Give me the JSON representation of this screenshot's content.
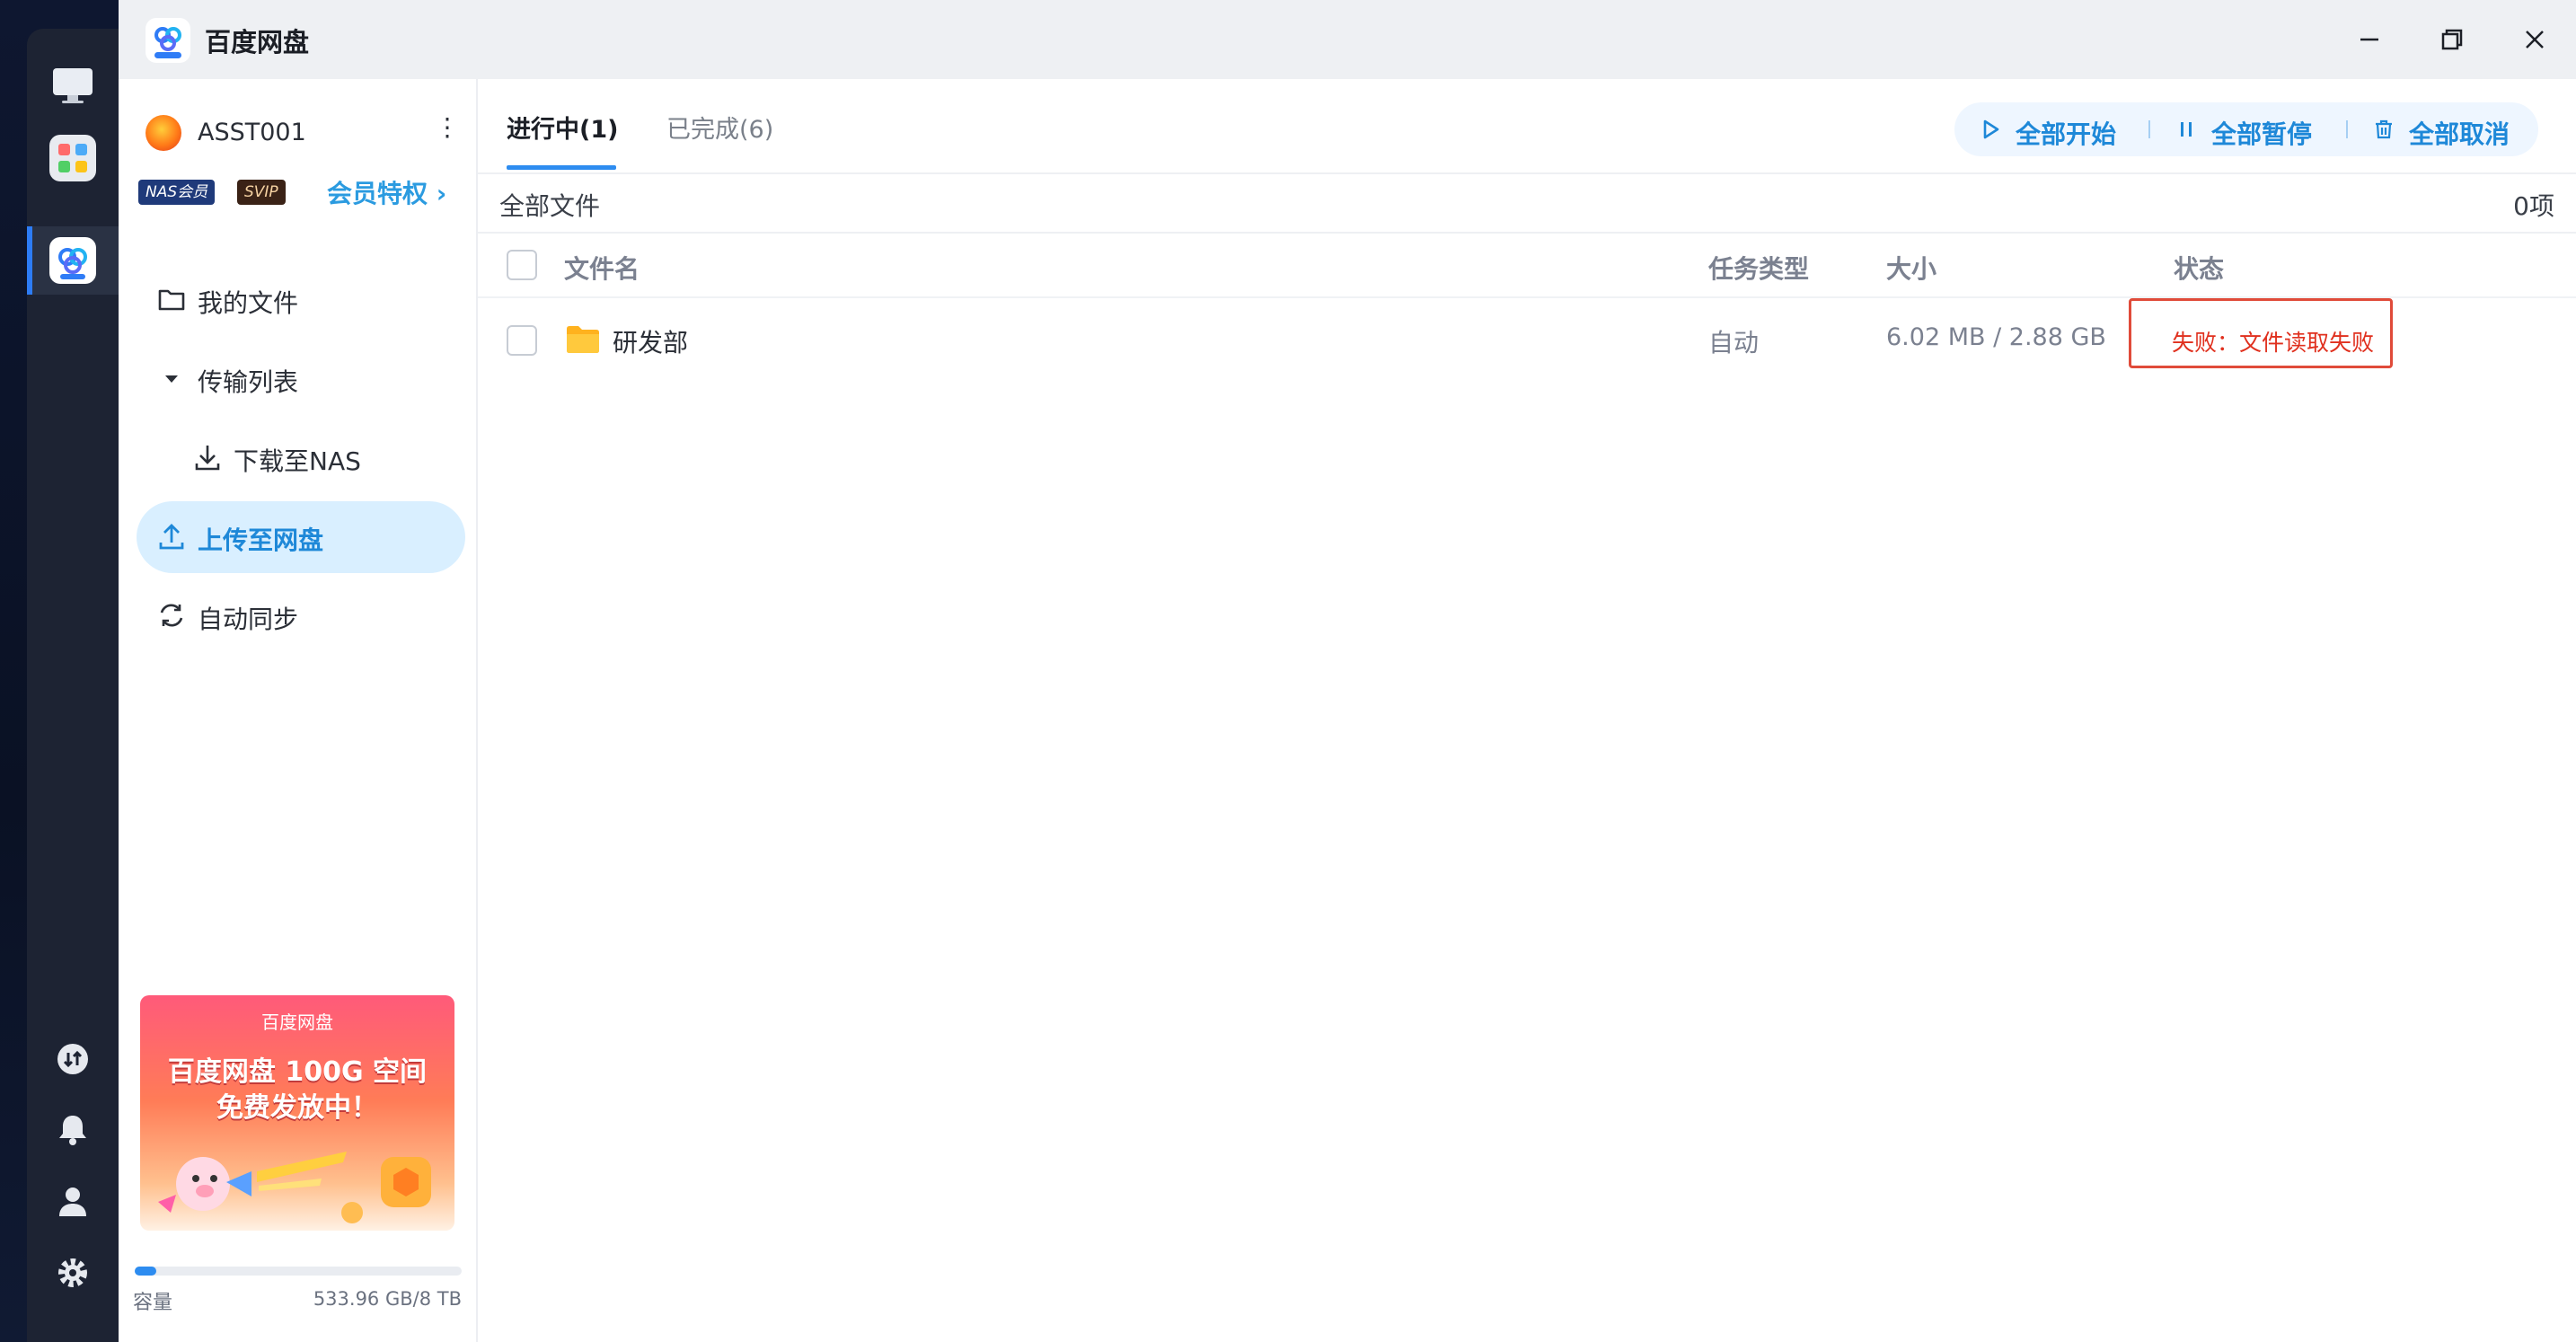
{
  "app": {
    "title": "百度网盘",
    "logo_icon": "baidu-netdisk-logo-icon",
    "window_controls": [
      "minimize-icon",
      "maximize-icon",
      "close-icon"
    ]
  },
  "dock": {
    "top_icons": [
      "monitor-icon",
      "app-grid-icon",
      "baidu-netdisk-app-icon"
    ],
    "bottom_icons": [
      "transfer-icon",
      "bell-icon",
      "user-icon",
      "gear-icon"
    ],
    "accent_color": "#2d7cf6"
  },
  "user": {
    "name": "ASST001",
    "badges": [
      "NAS会员",
      "SVIP"
    ],
    "vip_link": "会员特权 ›"
  },
  "nav": {
    "items": [
      {
        "label": "我的文件",
        "icon": "folder-outline-icon"
      },
      {
        "label": "传输列表",
        "icon": "caret-down-icon"
      },
      {
        "label": "下载至NAS",
        "icon": "download-icon"
      },
      {
        "label": "上传至网盘",
        "icon": "upload-icon",
        "active": true
      },
      {
        "label": "自动同步",
        "icon": "sync-icon"
      }
    ]
  },
  "banner": {
    "brand": "百度网盘",
    "line1": "百度网盘 100G 空间",
    "line2": "免费发放中！"
  },
  "capacity": {
    "label": "容量",
    "value": "533.96 GB/8 TB",
    "used_fraction": 0.065
  },
  "tabs": [
    {
      "label": "进行中(1)",
      "active": true
    },
    {
      "label": "已完成(6)",
      "active": false
    }
  ],
  "actions": [
    {
      "label": "全部开始",
      "icon": "play-icon"
    },
    {
      "label": "全部暂停",
      "icon": "pause-icon"
    },
    {
      "label": "全部取消",
      "icon": "trash-icon"
    }
  ],
  "subbar": {
    "breadcrumb": "全部文件",
    "count": "0项"
  },
  "table": {
    "columns": [
      "文件名",
      "任务类型",
      "大小",
      "状态"
    ],
    "rows": [
      {
        "name": "研发部",
        "type": "自动",
        "size": "6.02 MB / 2.88 GB",
        "status": "失败：文件读取失败"
      }
    ]
  },
  "colors": {
    "accent": "#2d8cf0",
    "error": "#e0301e"
  }
}
